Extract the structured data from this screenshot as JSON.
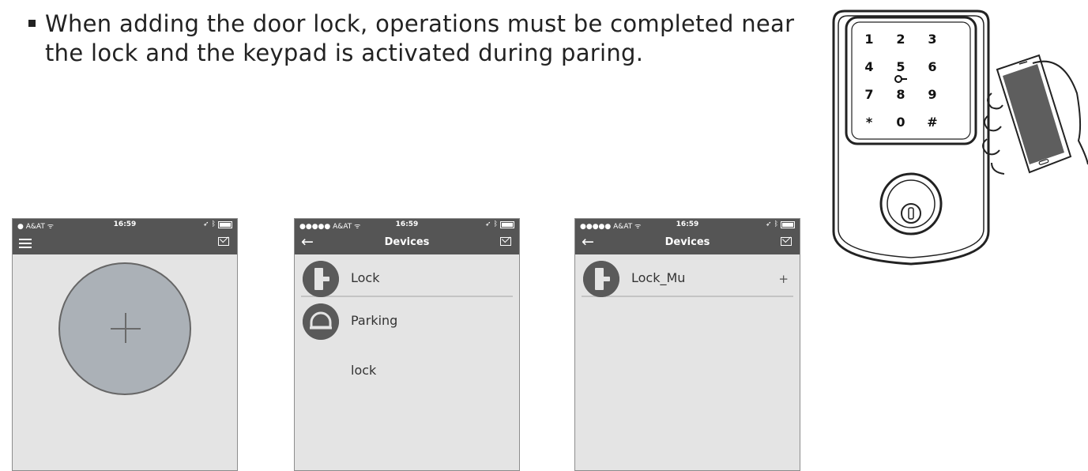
{
  "instruction": {
    "line1": "When adding the door lock, operations must be completed near",
    "line2": "the lock and the keypad is activated during paring."
  },
  "screen1": {
    "status": {
      "carrier": "A&AT",
      "time": "16:59"
    }
  },
  "screen2": {
    "status": {
      "carrier": "A&AT",
      "time": "16:59"
    },
    "title": "Devices",
    "devices": [
      {
        "label": "Lock"
      },
      {
        "label": "Parking",
        "extra": "lock"
      }
    ]
  },
  "screen3": {
    "status": {
      "carrier": "A&AT",
      "time": "16:59"
    },
    "title": "Devices",
    "devices": [
      {
        "label": "Lock_Mu",
        "action": "+"
      }
    ]
  },
  "keypad": {
    "keys": [
      "1",
      "2",
      "3",
      "4",
      "5",
      "6",
      "7",
      "8",
      "9",
      "*",
      "0",
      "#"
    ]
  }
}
